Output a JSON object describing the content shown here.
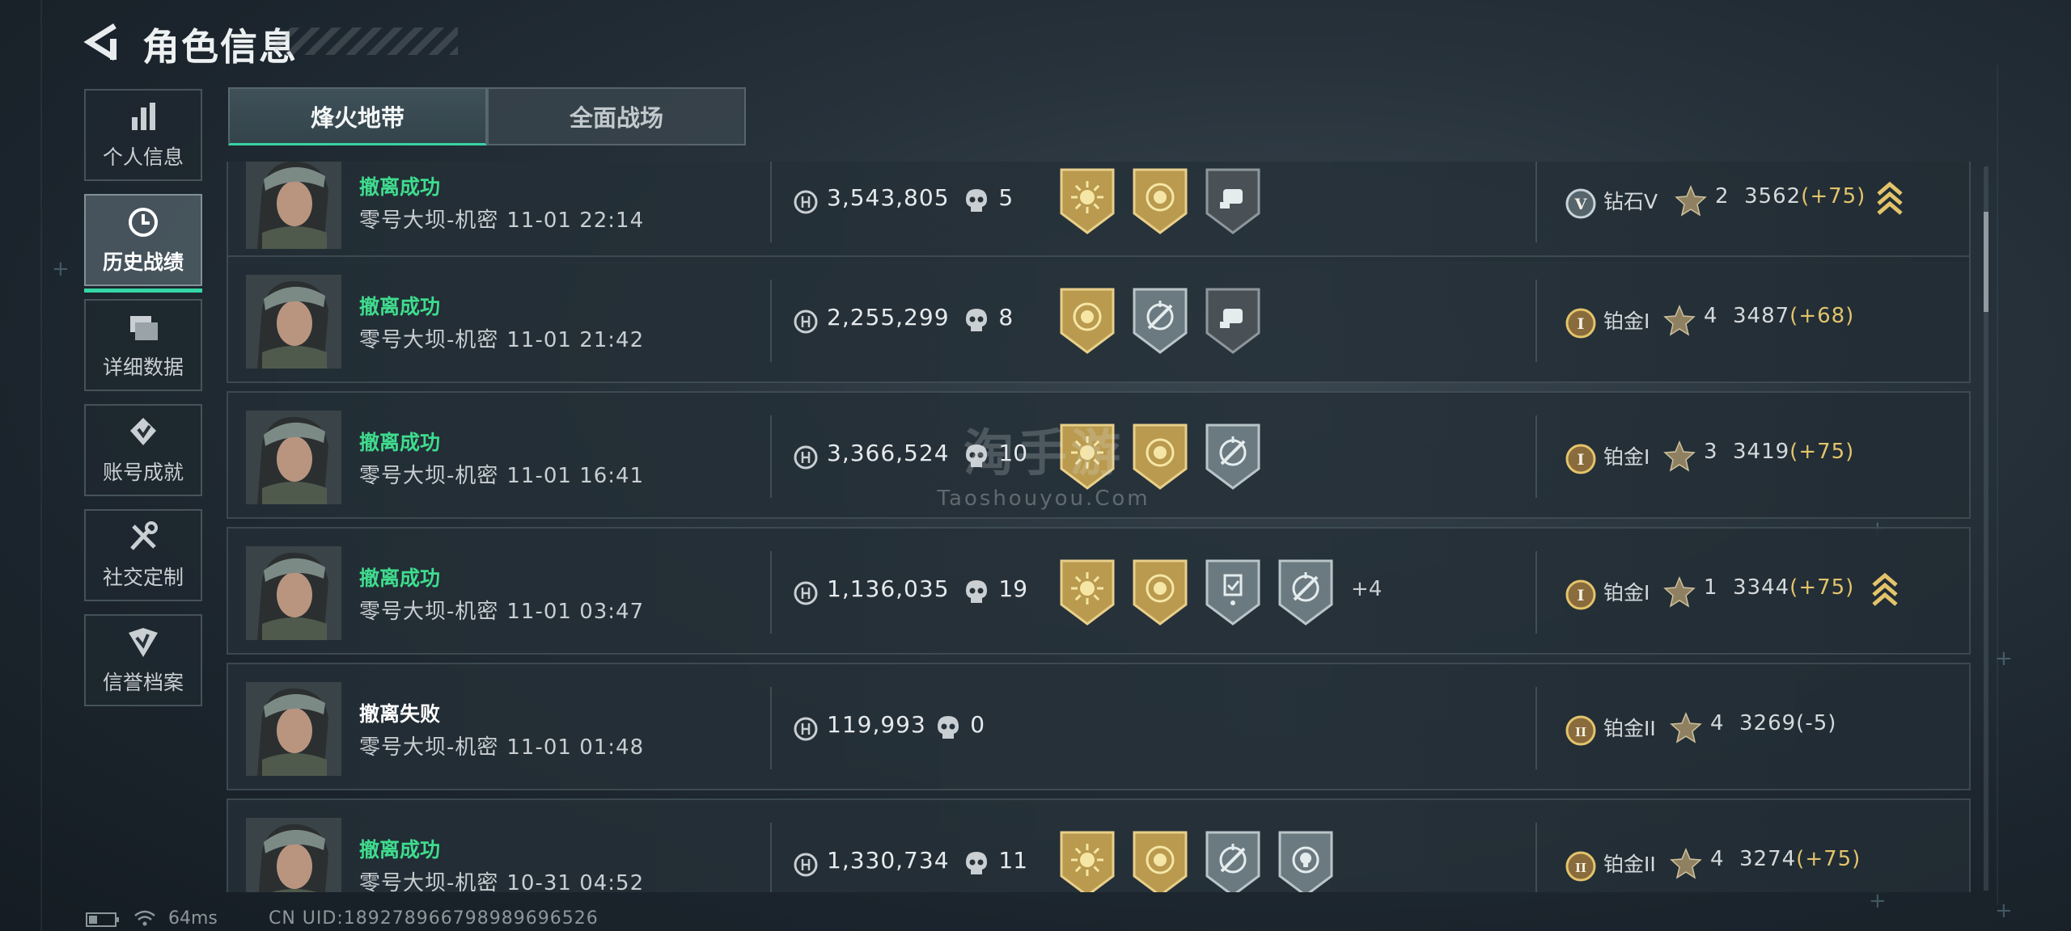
{
  "header": {
    "title": "角色信息",
    "back_icon": "back-arrow-icon"
  },
  "sidebar": {
    "items": [
      {
        "label": "个人信息",
        "icon": "bar-chart-icon",
        "active": false
      },
      {
        "label": "历史战绩",
        "icon": "clock-icon",
        "active": true
      },
      {
        "label": "详细数据",
        "icon": "folder-icon",
        "active": false
      },
      {
        "label": "账号成就",
        "icon": "achievement-icon",
        "active": false
      },
      {
        "label": "社交定制",
        "icon": "tools-icon",
        "active": false
      },
      {
        "label": "信誉档案",
        "icon": "shield-check-icon",
        "active": false
      }
    ]
  },
  "tabs": [
    {
      "label": "烽火地带",
      "active": true
    },
    {
      "label": "全面战场",
      "active": false
    }
  ],
  "matches": [
    {
      "status": "撤离成功",
      "map": "零号大坝-机密",
      "datetime": "11-01 22:14",
      "value": "3,543,805",
      "kills": "5",
      "badges": [
        "gold-sun-badge",
        "gold-emblem-badge",
        "dark-fist-badge"
      ],
      "more": "",
      "rank": "钻石V",
      "rank_icon": "V",
      "stars": "2",
      "score": "3562",
      "delta": "(+75)",
      "promo": true
    },
    {
      "status": "撤离成功",
      "map": "零号大坝-机密",
      "datetime": "11-01 21:42",
      "value": "2,255,299",
      "kills": "8",
      "badges": [
        "gold-emblem-badge",
        "silver-crosshair-badge",
        "dark-fist-badge"
      ],
      "more": "",
      "rank": "铂金I",
      "rank_icon": "I",
      "stars": "4",
      "score": "3487",
      "delta": "(+68)",
      "promo": false
    },
    {
      "status": "撤离成功",
      "map": "零号大坝-机密",
      "datetime": "11-01 16:41",
      "value": "3,366,524",
      "kills": "10",
      "badges": [
        "gold-sun-badge",
        "gold-emblem-badge",
        "silver-crosshair-badge"
      ],
      "more": "",
      "rank": "铂金I",
      "rank_icon": "I",
      "stars": "3",
      "score": "3419",
      "delta": "(+75)",
      "promo": false
    },
    {
      "status": "撤离成功",
      "map": "零号大坝-机密",
      "datetime": "11-01 03:47",
      "value": "1,136,035",
      "kills": "19",
      "badges": [
        "gold-sun-badge",
        "gold-emblem-badge",
        "silver-clipboard-badge",
        "silver-crosshair-badge"
      ],
      "more": "+4",
      "rank": "铂金I",
      "rank_icon": "I",
      "stars": "1",
      "score": "3344",
      "delta": "(+75)",
      "promo": true
    },
    {
      "status": "撤离失败",
      "map": "零号大坝-机密",
      "datetime": "11-01 01:48",
      "value": "119,993",
      "kills": "0",
      "badges": [],
      "more": "",
      "rank": "铂金II",
      "rank_icon": "II",
      "stars": "4",
      "score": "3269",
      "delta": "(-5)",
      "promo": false
    },
    {
      "status": "撤离成功",
      "map": "零号大坝-机密",
      "datetime": "10-31 04:52",
      "value": "1,330,734",
      "kills": "11",
      "badges": [
        "gold-sun-badge",
        "gold-emblem-badge",
        "silver-crosshair-badge",
        "silver-skull-target-badge"
      ],
      "more": "",
      "rank": "铂金II",
      "rank_icon": "II",
      "stars": "4",
      "score": "3274",
      "delta": "(+75)",
      "promo": false
    }
  ],
  "watermark": {
    "main": "淘手游",
    "sub": "Taoshouyou.Com"
  },
  "statusbar": {
    "ping": "64ms",
    "uid": "CN UID:189278966798989696526"
  },
  "colors": {
    "accent_green": "#38d3a3",
    "success_text": "#3fdc8e",
    "gold": "#e3c46b"
  }
}
